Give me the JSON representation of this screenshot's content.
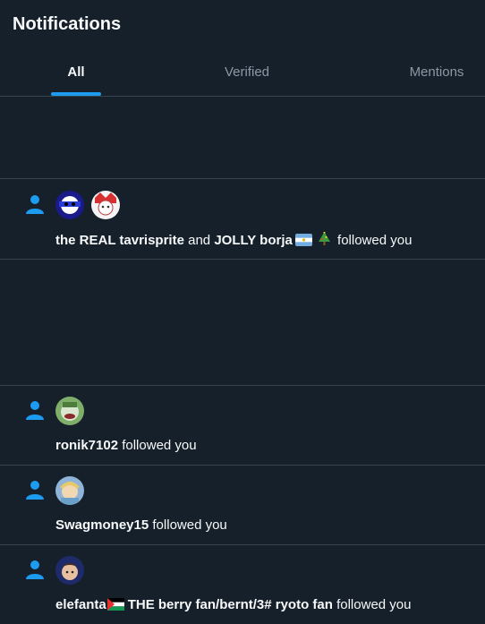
{
  "header": {
    "title": "Notifications"
  },
  "tabs": [
    {
      "label": "All",
      "active": true
    },
    {
      "label": "Verified",
      "active": false
    },
    {
      "label": "Mentions",
      "active": false
    }
  ],
  "notifications": [
    {
      "icon": "person-icon",
      "users": [
        "the REAL tavrisprite",
        "JOLLY borja"
      ],
      "connector": "and",
      "emoji_after_second": [
        "argentina-flag",
        "christmas-tree"
      ],
      "action": "followed you"
    },
    {
      "icon": "person-icon",
      "users": [
        "ronik7102"
      ],
      "action": "followed you"
    },
    {
      "icon": "person-icon",
      "users": [
        "Swagmoney15"
      ],
      "action": "followed you"
    },
    {
      "icon": "person-icon",
      "users": [
        "elefanta",
        "THE berry fan/bernt/3# ryoto fan"
      ],
      "emoji_between": "palestine-flag",
      "action": "followed you"
    }
  ],
  "colors": {
    "background": "#15202b",
    "accent": "#1d9bf0",
    "divider": "#38444d",
    "muted": "#8b98a5"
  }
}
